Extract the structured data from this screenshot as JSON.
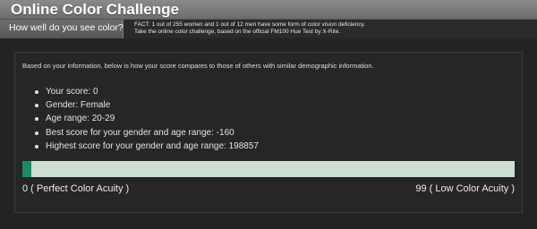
{
  "header": {
    "title": "Online Color Challenge"
  },
  "subheader": {
    "tab_label": "How well do you see color?",
    "fact_lines": [
      "FACT: 1 out of 255 women and 1 out of 12 men have some form of color vision deficiency.",
      "Take the online color challenge, based on the official FM100 Hue Test by X-Rite."
    ]
  },
  "results": {
    "intro": "Based on your information, below is how your score compares to those of others with similar demographic information.",
    "items": [
      "Your score: 0",
      "Gender: Female",
      "Age range: 20-29",
      "Best score for your gender and age range: -160",
      "Highest score for your gender and age range: 198857"
    ],
    "scale": {
      "min_label": "0 ( Perfect Color Acuity )",
      "max_label": "99 ( Low Color Acuity )",
      "score_fraction": 0.0
    }
  },
  "colors": {
    "scale_track": "#cfe0d0",
    "scale_marker": "#1e8a61",
    "title_bar": "#7a7a7a",
    "background": "#232323"
  }
}
